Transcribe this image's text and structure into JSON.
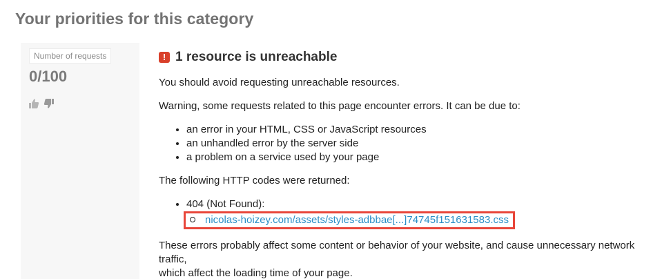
{
  "page": {
    "title": "Your priorities for this category"
  },
  "score": {
    "label": "Number of requests",
    "value": "0/100"
  },
  "icons": {
    "thumbs_up": "thumbs-up-icon",
    "thumbs_down": "thumbs-down-icon",
    "error": "error-badge-icon"
  },
  "colors": {
    "error_red": "#d9402b",
    "highlight_border": "#e8463a",
    "link_blue": "#2b8fc7"
  },
  "rule": {
    "badge": "!",
    "title": "1 resource is unreachable",
    "intro": "You should avoid requesting unreachable resources.",
    "warning": "Warning, some requests related to this page encounter errors. It can be due to:",
    "causes": [
      "an error in your HTML, CSS or JavaScript resources",
      "an unhandled error by the server side",
      "a problem on a service used by your page"
    ],
    "codes_intro": "The following HTTP codes were returned:",
    "code_label": "404 (Not Found):",
    "failed_url": "nicolas-hoizey.com/assets/styles-adbbae[...]74745f151631583.css",
    "conclusion_line1": "These errors probably affect some content or behavior of your website, and cause unnecessary network traffic,",
    "conclusion_line2": "which affect the loading time of your page."
  }
}
